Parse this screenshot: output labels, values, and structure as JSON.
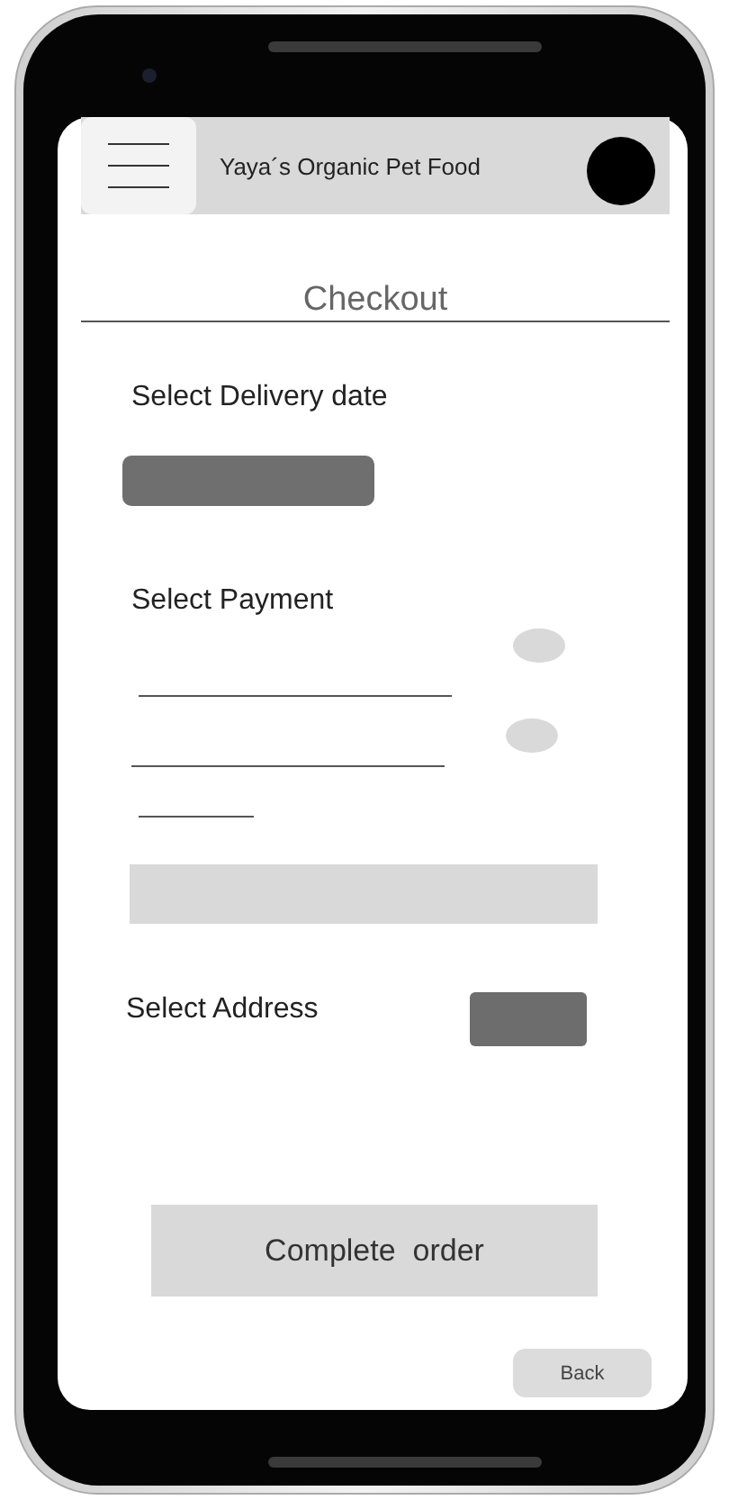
{
  "header": {
    "title": "Yaya´s Organic Pet Food"
  },
  "page_title": "Checkout",
  "delivery": {
    "label": "Select Delivery date"
  },
  "payment": {
    "label": "Select Payment",
    "options": [
      {
        "selected": false
      },
      {
        "selected": false
      }
    ]
  },
  "address": {
    "label": "Select Address"
  },
  "buttons": {
    "complete": "Complete  order",
    "back": "Back"
  }
}
